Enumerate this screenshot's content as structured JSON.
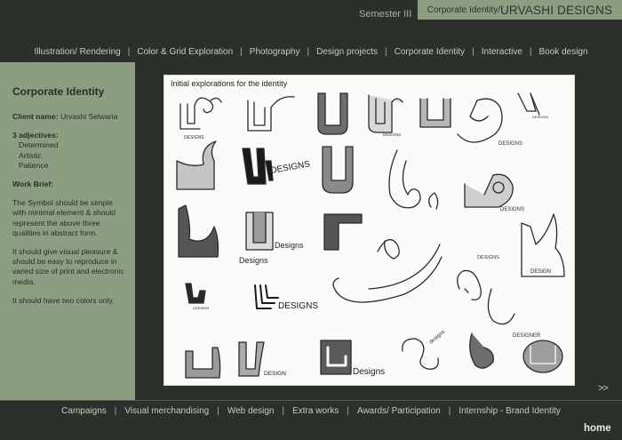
{
  "header": {
    "semester": "Semester III",
    "title_prefix": "Corporate Identity/",
    "title_name": " URVASHI DESIGNS"
  },
  "top_nav": [
    "Illustration/ Rendering",
    "Color & Grid Exploration",
    "Photography",
    "Design projects",
    "Corporate Identity",
    "Interactive",
    "Book design"
  ],
  "sidebar": {
    "heading": "Corporate Identity",
    "client_label": "Client name:",
    "client_value": " Urvashi Selwaria",
    "adjectives_label": "3 adjectives:",
    "adjectives": [
      "Determined",
      "Artistic",
      "Patience"
    ],
    "brief_label": "Work Brief:",
    "brief_paragraphs": [
      "The Symbol should be simple with minimal element & should represent the above three qualities in abstract form.",
      "It should give visual pleasure & should be easy to reproduce in varied size of print and electronic media.",
      "It should have two colors only."
    ]
  },
  "board": {
    "caption": "Initial explorations for the identity",
    "sketch_words": {
      "designs": "DESIGNS",
      "designs_lower": "Designs",
      "design": "DESIGN",
      "designer": "DESIGNER",
      "udesigns": "UDESIGNS",
      "udesign": "UDESIGN",
      "designs_script": "designs"
    }
  },
  "next_label": ">>",
  "bottom_nav": [
    "Campaigns",
    "Visual merchandising",
    "Web design",
    "Extra works",
    "Awards/ Participation",
    "Internship - Brand Identity"
  ],
  "home_label": "home"
}
